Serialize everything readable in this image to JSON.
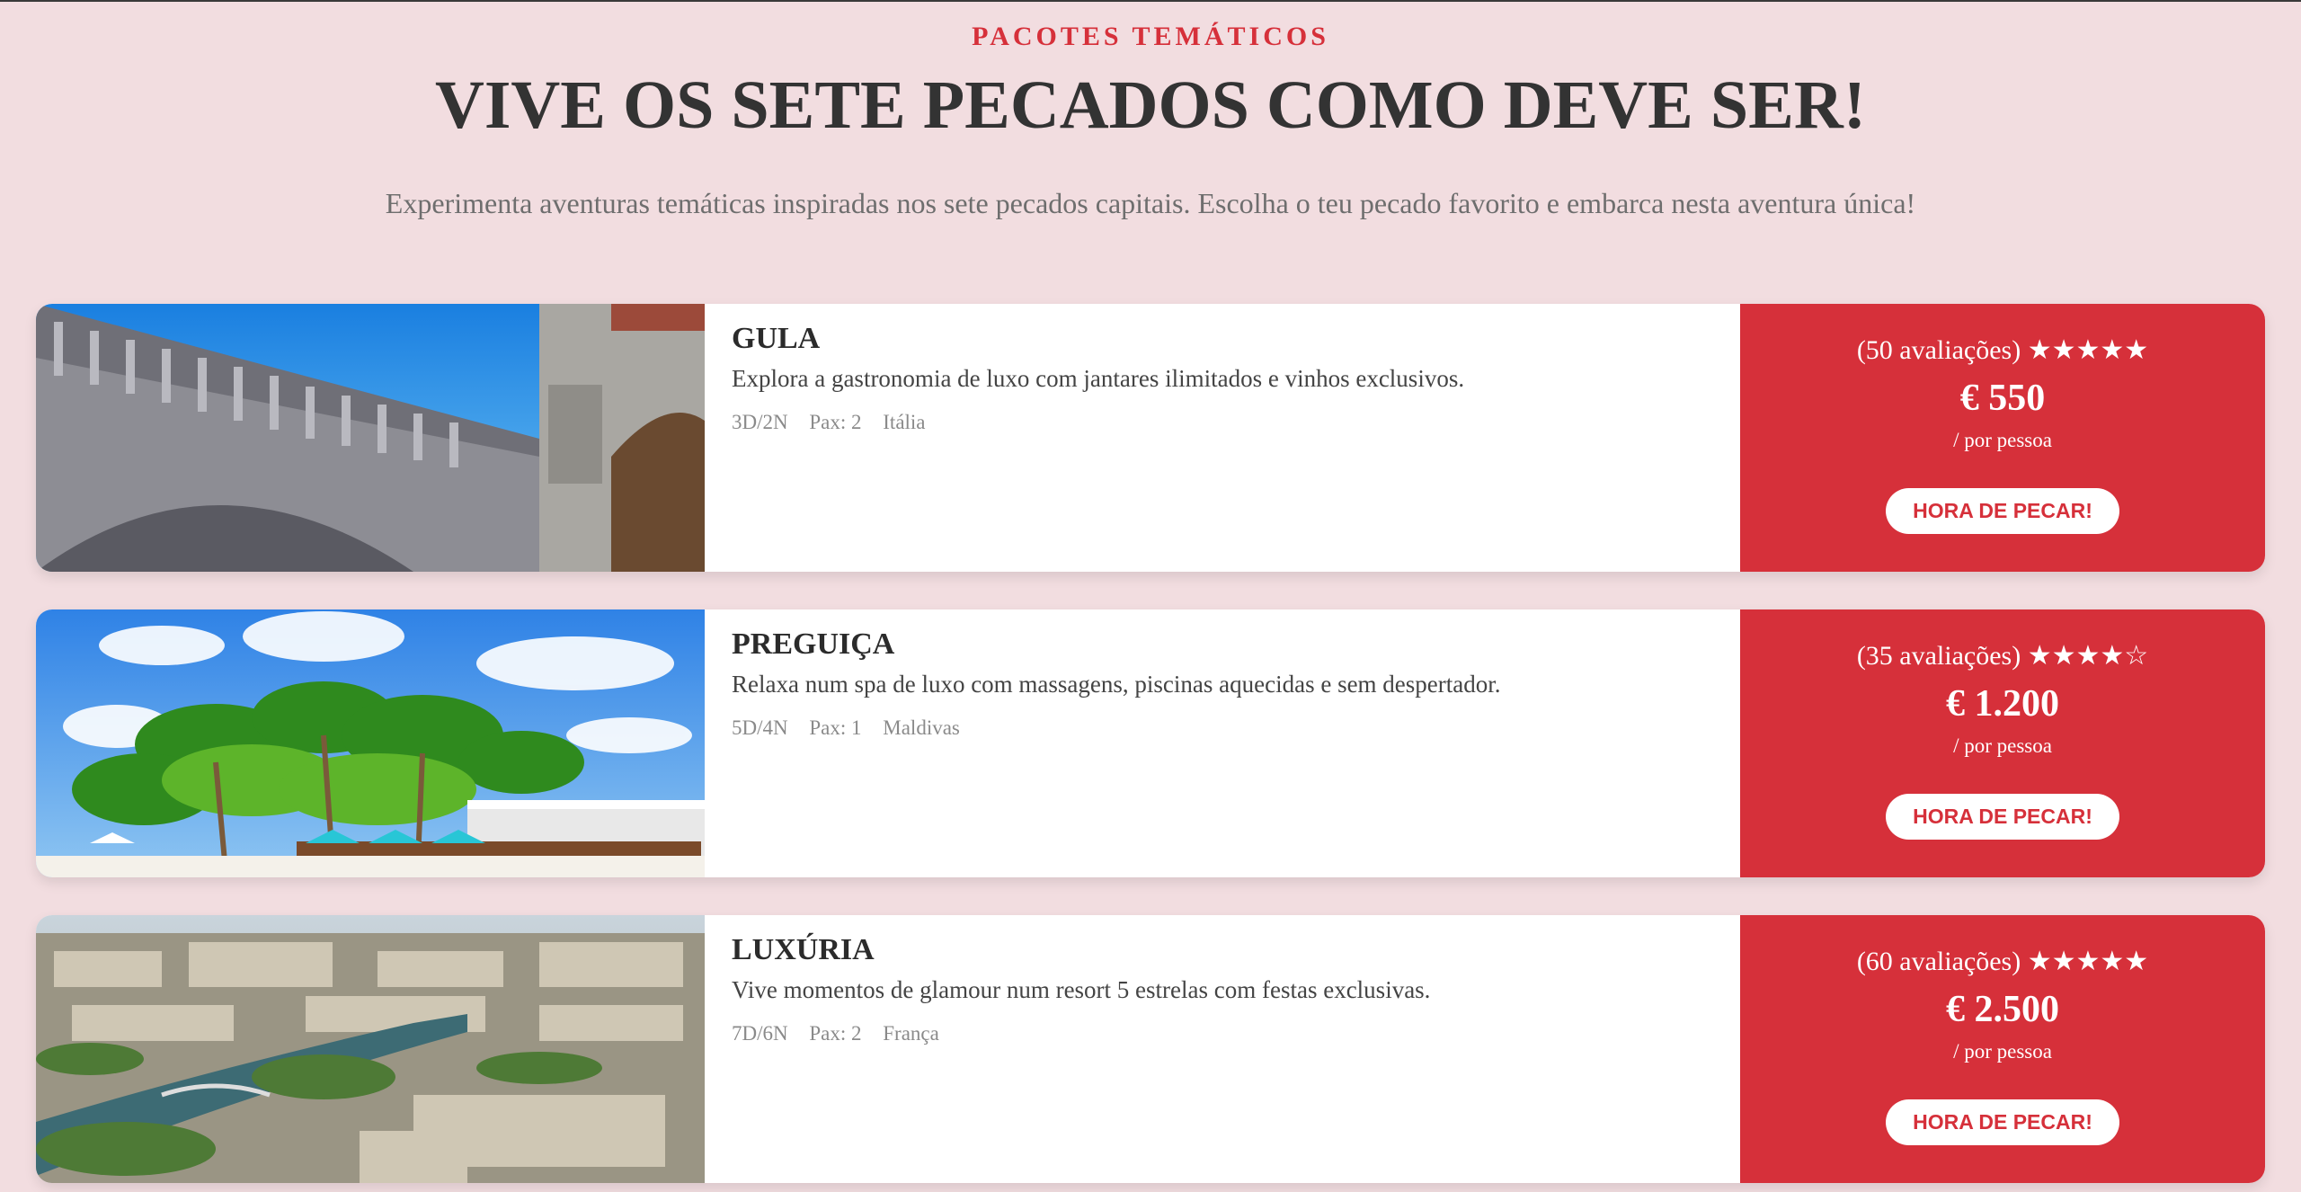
{
  "header": {
    "eyebrow": "PACOTES TEMÁTICOS",
    "title": "VIVE OS SETE PECADOS COMO DEVE SER!",
    "subtitle": "Experimenta aventuras temáticas inspiradas nos sete pecados capitais. Escolha o teu pecado favorito e embarca nesta aventura única!"
  },
  "colors": {
    "background": "#f2dde0",
    "accent": "#d6303a",
    "card": "#ffffff"
  },
  "packages": [
    {
      "name": "GULA",
      "description": "Explora a gastronomia de luxo com jantares ilimitados e vinhos exclusivos.",
      "duration": "3D/2N",
      "pax": "Pax: 2",
      "country": "Itália",
      "rating_text": "(50 avaliações) ★★★★★",
      "rating": 5,
      "price": "€ 550",
      "per": "/ por pessoa",
      "cta": "HORA DE PECAR!",
      "image": "venice-bridge-photo"
    },
    {
      "name": "PREGUIÇA",
      "description": "Relaxa num spa de luxo com massagens, piscinas aquecidas e sem despertador.",
      "duration": "5D/4N",
      "pax": "Pax: 1",
      "country": "Maldivas",
      "rating_text": "(35 avaliações) ★★★★☆",
      "rating": 4,
      "price": "€ 1.200",
      "per": "/ por pessoa",
      "cta": "HORA DE PECAR!",
      "image": "tropical-palms-photo"
    },
    {
      "name": "LUXÚRIA",
      "description": "Vive momentos de glamour num resort 5 estrelas com festas exclusivas.",
      "duration": "7D/6N",
      "pax": "Pax: 2",
      "country": "França",
      "rating_text": "(60 avaliações) ★★★★★",
      "rating": 5,
      "price": "€ 2.500",
      "per": "/ por pessoa",
      "cta": "HORA DE PECAR!",
      "image": "paris-aerial-photo"
    }
  ]
}
